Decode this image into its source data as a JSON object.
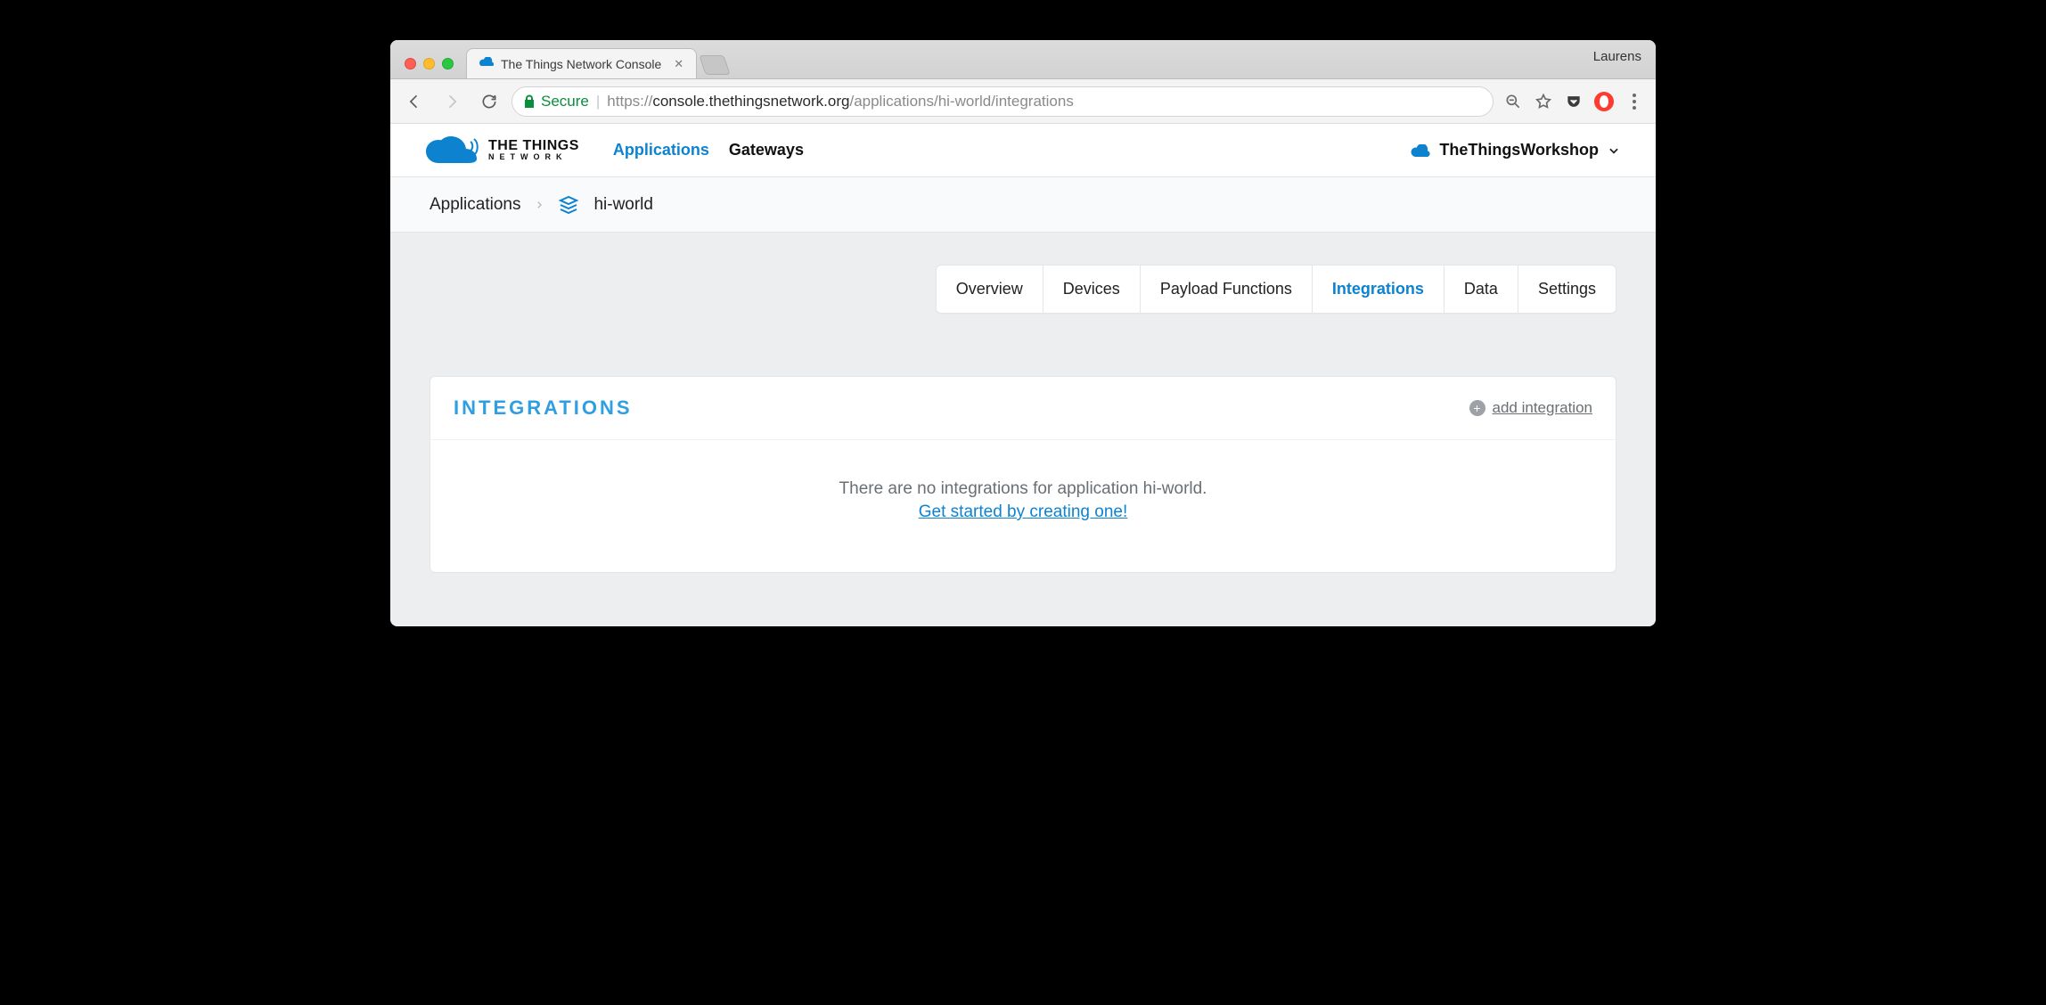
{
  "browser": {
    "profile_name": "Laurens",
    "tab_title": "The Things Network Console",
    "secure_label": "Secure",
    "url_scheme": "https://",
    "url_host": "console.thethingsnetwork.org",
    "url_path": "/applications/hi-world/integrations"
  },
  "header": {
    "brand_line1": "THE THINGS",
    "brand_line2": "NETWORK",
    "nav": {
      "applications": "Applications",
      "gateways": "Gateways"
    },
    "user_label": "TheThingsWorkshop"
  },
  "breadcrumb": {
    "root": "Applications",
    "app": "hi-world"
  },
  "tabs": {
    "overview": "Overview",
    "devices": "Devices",
    "payload_functions": "Payload Functions",
    "integrations": "Integrations",
    "data": "Data",
    "settings": "Settings"
  },
  "panel": {
    "title": "INTEGRATIONS",
    "add_label": "add integration",
    "empty_text": "There are no integrations for application hi-world.",
    "cta_text": "Get started by creating one!"
  }
}
